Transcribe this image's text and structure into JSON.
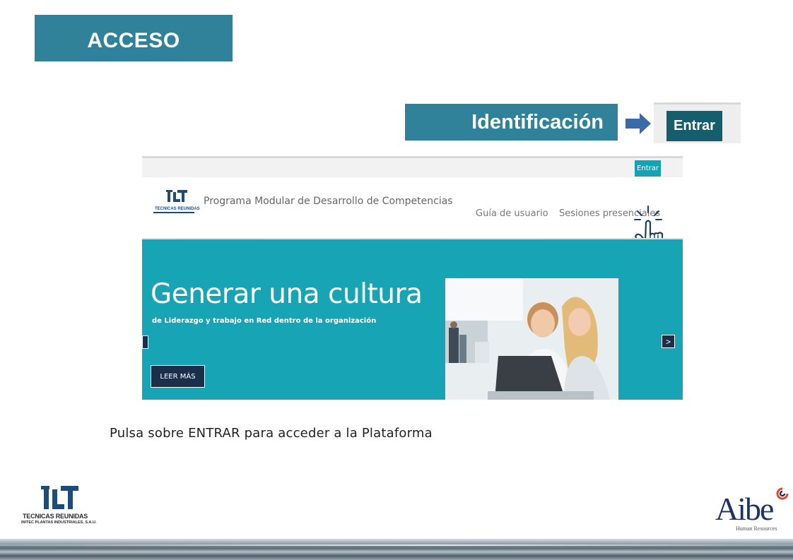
{
  "slide": {
    "title": "ACCESO",
    "identification_label": "Identificación",
    "entrar_zoom_label": "Entrar",
    "caption": "Pulsa sobre ENTRAR para acceder a la Plataforma"
  },
  "screenshot": {
    "topbar_entrar": "Entrar",
    "site_title": "Programa Modular de Desarrollo de Competencias",
    "logo_text": "TECNICAS REUNIDAS",
    "nav": {
      "guia": "Guía de usuario",
      "sesiones": "Sesiones presenciales"
    },
    "banner": {
      "title": "Generar una cultura",
      "subtitle": "de Liderazgo y trabajo en Red dentro de la organización",
      "button": "LEER MÁS",
      "next_glyph": ">"
    }
  },
  "footer": {
    "left_logo": {
      "line1": "TECNICAS REUNIDAS",
      "line2": "INITEC PLANTAS INDUSTRIALES, S.A.U."
    },
    "right_logo": {
      "word": "Aibe",
      "tagline": "Human Resources"
    }
  },
  "colors": {
    "accent": "#2f8299",
    "banner": "#17a5b5",
    "dark_button": "#1c2f4a",
    "entrar_dark": "#145e6d",
    "aibe_blue": "#1e3466"
  },
  "icons": [
    "right-arrow-icon",
    "pointer-hand-icon",
    "chevron-left-icon",
    "chevron-right-icon"
  ]
}
